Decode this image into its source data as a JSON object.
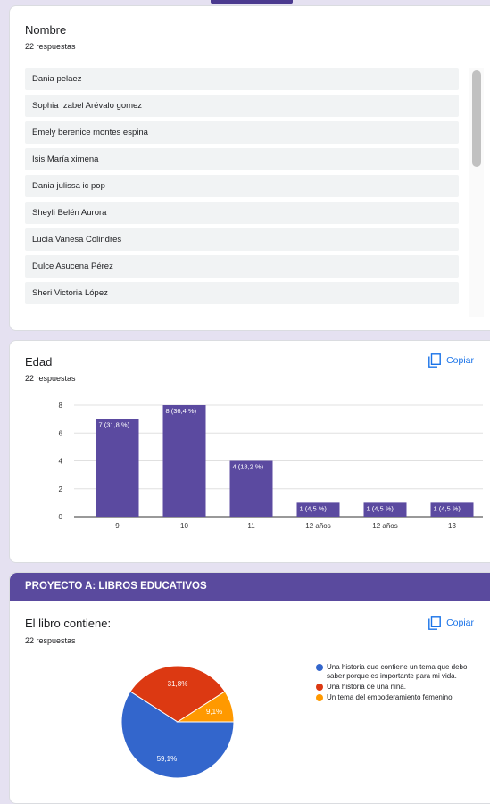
{
  "card_names": {
    "title": "Nombre",
    "responses": "22 respuestas",
    "items": [
      "Dania pelaez",
      "Sophia Izabel Arévalo gomez",
      "Emely berenice montes espina",
      "Isis María ximena",
      "Dania julissa ic pop",
      "Sheyli Belén Aurora",
      "Lucía Vanesa Colindres",
      "Dulce Asucena Pérez",
      "Sheri Victoria López"
    ]
  },
  "card_age": {
    "title": "Edad",
    "responses": "22 respuestas",
    "copy_label": "Copiar"
  },
  "section": {
    "title": "PROYECTO A: LIBROS EDUCATIVOS"
  },
  "card_book": {
    "title": "El libro contiene:",
    "responses": "22 respuestas",
    "copy_label": "Copiar"
  },
  "chart_data": [
    {
      "type": "bar",
      "categories": [
        "9",
        "10",
        "11",
        "12 años",
        "12 años",
        "13"
      ],
      "values": [
        7,
        8,
        4,
        1,
        1,
        1
      ],
      "data_labels": [
        "7 (31,8 %)",
        "8 (36,4 %)",
        "4 (18,2 %)",
        "1 (4,5 %)",
        "1 (4,5 %)",
        "1 (4,5 %)"
      ],
      "ylim": [
        0,
        8
      ],
      "yticks": [
        0,
        2,
        4,
        6,
        8
      ],
      "color": "#5b4aa0",
      "grid": true
    },
    {
      "type": "pie",
      "labels": [
        "Una historia que contiene un tema que debo saber porque es importante para mi vida.",
        "Una historia de una niña.",
        "Un tema del empoderamiento femenino."
      ],
      "values": [
        59.1,
        31.8,
        9.1
      ],
      "data_labels": [
        "59,1%",
        "31,8%",
        "9,1%"
      ],
      "colors": [
        "#3366cc",
        "#dc3912",
        "#ff9900"
      ],
      "legend": "right"
    }
  ]
}
